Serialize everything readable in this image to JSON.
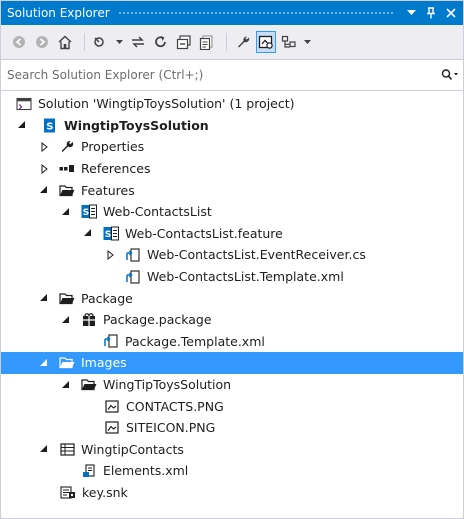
{
  "window": {
    "title": "Solution Explorer"
  },
  "search": {
    "placeholder": "Search Solution Explorer (Ctrl+;)"
  },
  "tree": {
    "solution": "Solution 'WingtipToysSolution' (1 project)",
    "project": "WingtipToysSolution",
    "properties": "Properties",
    "references": "References",
    "features": "Features",
    "web_contacts_list": "Web-ContactsList",
    "feature_file": "Web-ContactsList.feature",
    "event_receiver": "Web-ContactsList.EventReceiver.cs",
    "feature_template": "Web-ContactsList.Template.xml",
    "package": "Package",
    "package_file": "Package.package",
    "package_template": "Package.Template.xml",
    "images": "Images",
    "images_folder": "WingTipToysSolution",
    "contacts_png": "CONTACTS.PNG",
    "siteicon_png": "SITEICON.PNG",
    "wingtip_contacts": "WingtipContacts",
    "elements_xml": "Elements.xml",
    "key_snk": "key.snk"
  },
  "colors": {
    "accent": "#007acc",
    "selection": "#3399ff",
    "toolbar_bg": "#eeeef2"
  }
}
